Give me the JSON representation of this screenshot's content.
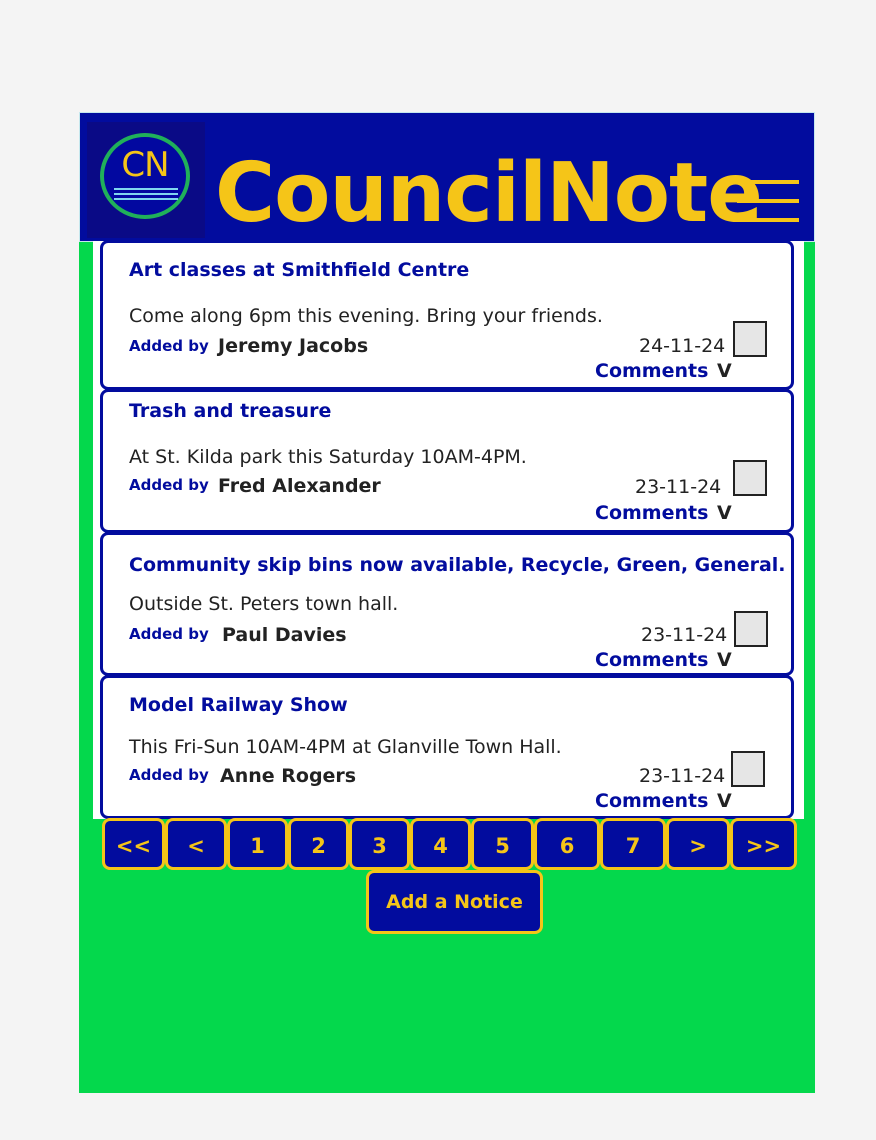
{
  "app": {
    "title": "CouncilNote",
    "logo_text": "CN"
  },
  "colors": {
    "brand_blue": "#020c9e",
    "accent_yellow": "#f5c518",
    "background_green": "#04d84c"
  },
  "icons": {
    "menu": "hamburger-menu-icon"
  },
  "notices": [
    {
      "title": "Art classes at Smithfield Centre",
      "body": "Come along 6pm this evening. Bring your friends.",
      "added_by_label": "Added by",
      "author": "Jeremy Jacobs",
      "date": "24-11-24",
      "comments_label": "Comments",
      "toggle": "V"
    },
    {
      "title": "Trash and treasure",
      "body": "At St. Kilda park this Saturday 10AM-4PM.",
      "added_by_label": "Added by",
      "author": "Fred Alexander",
      "date": "23-11-24",
      "comments_label": "Comments",
      "toggle": "V"
    },
    {
      "title": "Community skip bins now available, Recycle, Green, General.",
      "body": "Outside St. Peters town hall.",
      "added_by_label": "Added by",
      "author": "Paul Davies",
      "date": "23-11-24",
      "comments_label": "Comments",
      "toggle": "V"
    },
    {
      "title": "Model Railway Show",
      "body": "This Fri-Sun 10AM-4PM at Glanville Town Hall.",
      "added_by_label": "Added by",
      "author": "Anne Rogers",
      "date": "23-11-24",
      "comments_label": "Comments",
      "toggle": "V"
    }
  ],
  "pagination": [
    "<<",
    "<",
    "1",
    "2",
    "3",
    "4",
    "5",
    "6",
    "7",
    ">",
    ">>"
  ],
  "add_button_label": "Add a Notice"
}
